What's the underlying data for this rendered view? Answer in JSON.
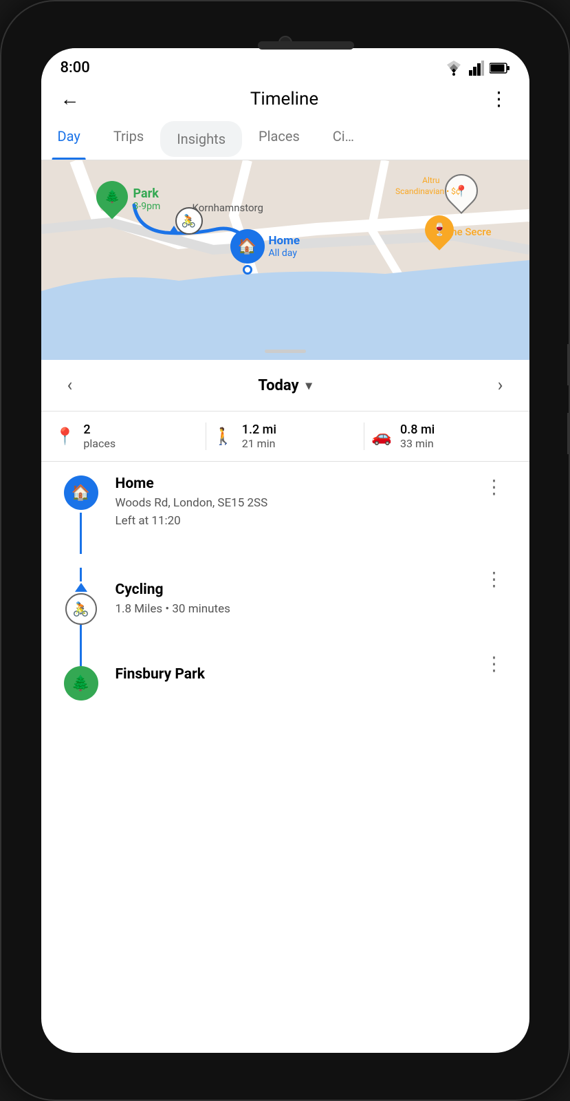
{
  "phone": {
    "status": {
      "time": "8:00"
    }
  },
  "app": {
    "title": "Timeline",
    "back_label": "←",
    "more_label": "⋮"
  },
  "tabs": [
    {
      "id": "day",
      "label": "Day",
      "active": true
    },
    {
      "id": "trips",
      "label": "Trips",
      "active": false
    },
    {
      "id": "insights",
      "label": "Insights",
      "active": false
    },
    {
      "id": "places",
      "label": "Places",
      "active": false
    },
    {
      "id": "cities",
      "label": "Ci…",
      "active": false
    }
  ],
  "map": {
    "park_label": "Park",
    "park_time": "3-9pm",
    "home_label": "Home",
    "home_time": "All day",
    "kornhamnstorg": "Kornhamnstorg",
    "scandinavian": "Scandinavian • $¢",
    "the_secret": "The Secre",
    "altru": "Altru"
  },
  "date_nav": {
    "prev_label": "‹",
    "next_label": "›",
    "current": "Today",
    "chevron": "▾"
  },
  "stats": {
    "places_count": "2",
    "places_label": "places",
    "walk_distance": "1.2 mi",
    "walk_time": "21 min",
    "drive_distance": "0.8 mi",
    "drive_time": "33 min"
  },
  "timeline": {
    "items": [
      {
        "id": "home",
        "type": "place",
        "title": "Home",
        "address": "Woods Rd, London, SE15 2SS",
        "detail": "Left at 11:20"
      },
      {
        "id": "cycling",
        "type": "transport",
        "title": "Cycling",
        "detail": "1.8 Miles • 30 minutes"
      },
      {
        "id": "finsbury",
        "type": "place",
        "title": "Finsbury Park",
        "address": "",
        "detail": ""
      }
    ]
  }
}
